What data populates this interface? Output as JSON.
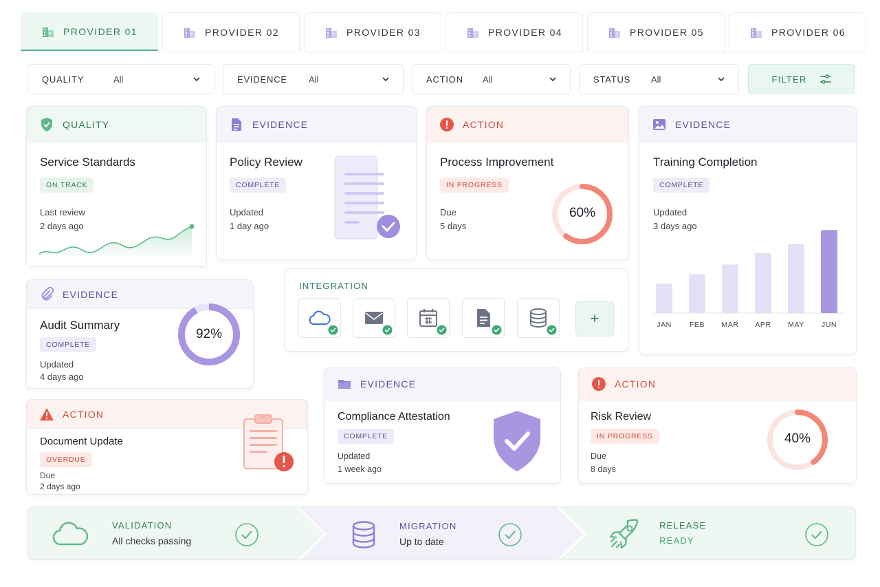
{
  "tabs": [
    {
      "label": "PROVIDER 01",
      "icon": "building-icon",
      "active": true
    },
    {
      "label": "PROVIDER 02",
      "icon": "building-icon",
      "active": false
    },
    {
      "label": "PROVIDER 03",
      "icon": "building-icon",
      "active": false
    },
    {
      "label": "PROVIDER 04",
      "icon": "building-icon",
      "active": false
    },
    {
      "label": "PROVIDER 05",
      "icon": "building-icon",
      "active": false
    },
    {
      "label": "PROVIDER 06",
      "icon": "building-icon",
      "active": false
    }
  ],
  "filters": [
    {
      "label": "QUALITY",
      "value": "All"
    },
    {
      "label": "EVIDENCE",
      "value": "All"
    },
    {
      "label": "ACTION",
      "value": "All"
    },
    {
      "label": "STATUS",
      "value": "All"
    }
  ],
  "filter_button": {
    "label": "FILTER",
    "icon": "sliders-icon"
  },
  "colors": {
    "green": "#2f7f5c",
    "purple": "#5a4f9e",
    "red": "#cf4b3c",
    "accent_purple": "#a996e0",
    "accent_red": "#f28778"
  },
  "cards": {
    "service": {
      "category": "QUALITY",
      "icon": "shield-check-icon",
      "title": "Service Standards",
      "badge": "ON TRACK",
      "meta_label": "Last review",
      "meta_value": "2 days ago"
    },
    "policy": {
      "category": "EVIDENCE",
      "icon": "document-icon",
      "title": "Policy Review",
      "badge": "COMPLETE",
      "meta_label": "Updated",
      "meta_value": "1 day ago"
    },
    "process": {
      "category": "ACTION",
      "icon": "alert-circle-icon",
      "title": "Process Improvement",
      "badge": "IN PROGRESS",
      "meta_label": "Due",
      "meta_value": "5 days",
      "progress_label": "60%",
      "progress": 0.6
    },
    "training": {
      "category": "EVIDENCE",
      "icon": "image-icon",
      "title": "Training Completion",
      "badge": "COMPLETE",
      "meta_label": "Updated",
      "meta_value": "3 days ago"
    },
    "audit": {
      "category": "EVIDENCE",
      "icon": "paperclip-icon",
      "title": "Audit Summary",
      "badge": "COMPLETE",
      "meta_label": "Updated",
      "meta_value": "4 days ago",
      "progress_label": "92%",
      "progress": 0.92
    },
    "document": {
      "category": "ACTION",
      "icon": "warning-triangle-icon",
      "title": "Document Update",
      "badge": "OVERDUE",
      "meta_label": "Due",
      "meta_value": "2 days ago"
    },
    "compliance": {
      "category": "EVIDENCE",
      "icon": "folder-icon",
      "title": "Compliance Attestation",
      "badge": "COMPLETE",
      "meta_label": "Updated",
      "meta_value": "1 week ago"
    },
    "risk": {
      "category": "ACTION",
      "icon": "alert-circle-icon",
      "title": "Risk Review",
      "badge": "IN PROGRESS",
      "meta_label": "Due",
      "meta_value": "8 days",
      "progress_label": "40%",
      "progress": 0.4
    }
  },
  "integration": {
    "label": "INTEGRATION",
    "tiles": [
      "cloud-icon",
      "mail-icon",
      "calendar-icon",
      "file-icon",
      "database-icon"
    ],
    "add_label": "+"
  },
  "chart_data": {
    "type": "bar",
    "categories": [
      "JAN",
      "FEB",
      "MAR",
      "APR",
      "MAY",
      "JUN"
    ],
    "values": [
      46,
      61,
      76,
      94,
      108,
      130
    ],
    "ylim": [
      0,
      140
    ],
    "grid": false,
    "legend": "none",
    "highlight_last": true
  },
  "pipeline": [
    {
      "title": "VALIDATION",
      "subtitle": "All checks passing",
      "icon": "cloud-icon"
    },
    {
      "title": "MIGRATION",
      "subtitle": "Up to date",
      "icon": "database-icon"
    },
    {
      "title": "RELEASE",
      "subtitle": "READY",
      "icon": "rocket-icon"
    }
  ]
}
